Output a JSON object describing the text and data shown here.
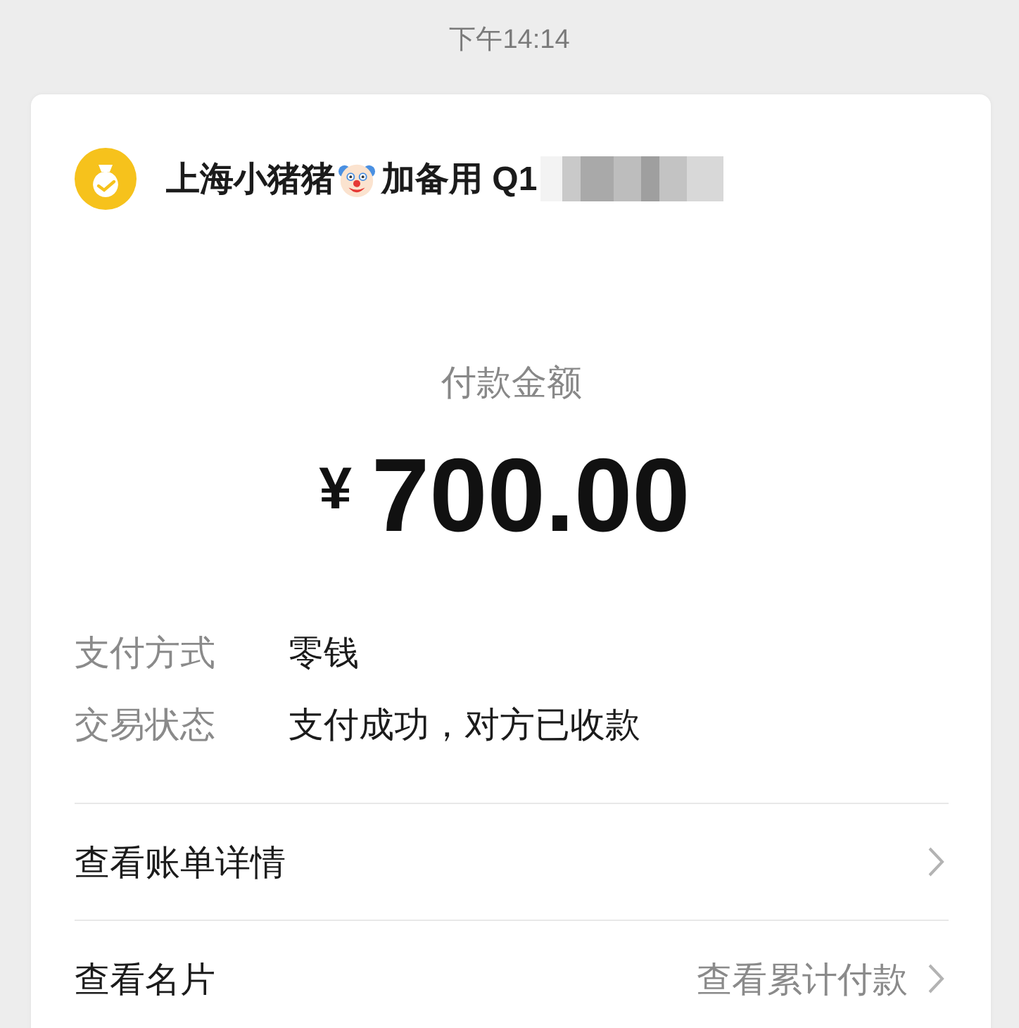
{
  "status_bar": {
    "time": "下午14:14"
  },
  "payee": {
    "name": "上海小猪猪",
    "note": "加备用 Q1"
  },
  "amount": {
    "label": "付款金额",
    "currency": "¥",
    "value": "700.00"
  },
  "details": [
    {
      "label": "支付方式",
      "value": "零钱"
    },
    {
      "label": "交易状态",
      "value": "支付成功，对方已收款"
    }
  ],
  "links": [
    {
      "label": "查看账单详情"
    },
    {
      "label": "查看名片",
      "extra": "查看累计付款"
    }
  ]
}
